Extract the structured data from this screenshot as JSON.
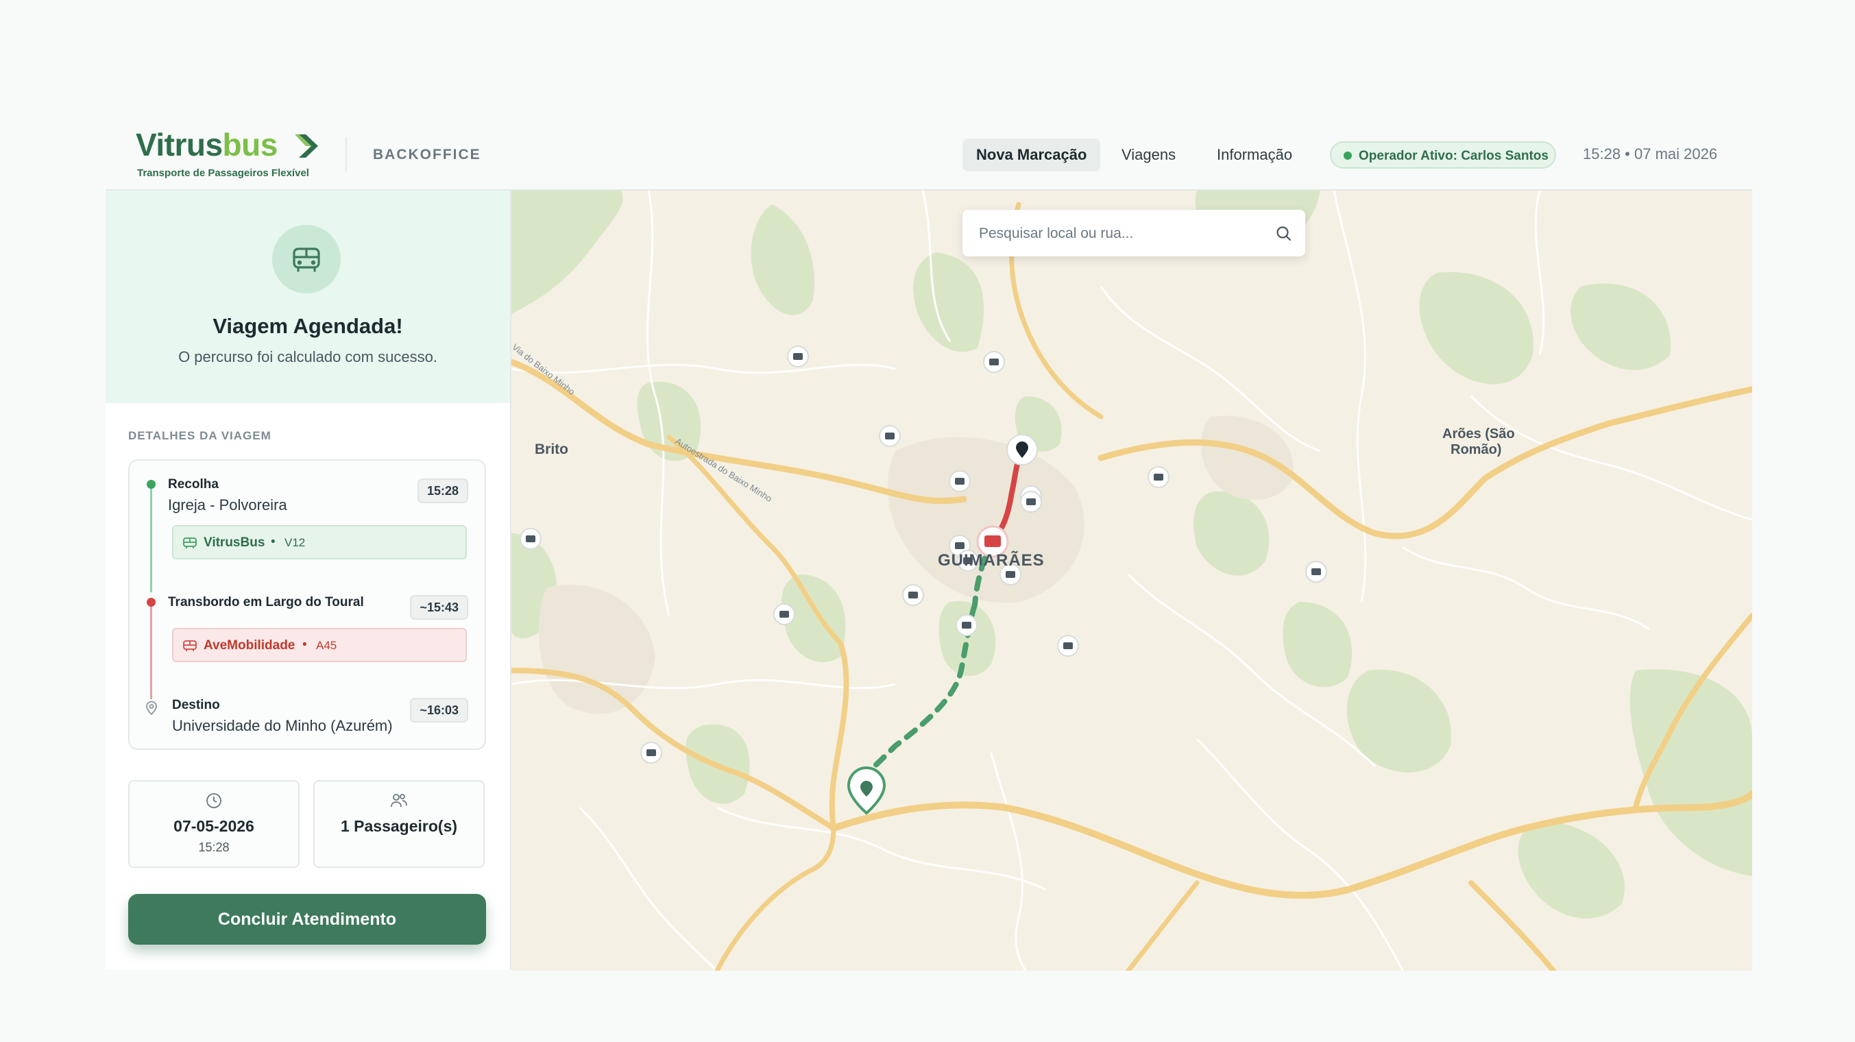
{
  "brand": {
    "name_part1": "Vitrus",
    "name_part2": "bus",
    "tagline": "Transporte de Passageiros Flexível",
    "section": "BACKOFFICE"
  },
  "nav": {
    "items": [
      {
        "label": "Nova Marcação",
        "active": true
      },
      {
        "label": "Viagens"
      },
      {
        "label": "Informação"
      }
    ]
  },
  "operator_badge": "Operador Ativo: Carlos Santos",
  "datetime": "15:28 • 07 mai 2026",
  "success": {
    "title": "Viagem Agendada!",
    "subtitle": "O percurso foi calculado com sucesso."
  },
  "details": {
    "label": "DETALHES DA VIAGEM",
    "steps": [
      {
        "title": "Recolha",
        "place": "Igreja - Polvoreira",
        "time": "15:28",
        "operator": "VitrusBus",
        "line": "V12",
        "color": "#3aa45d"
      },
      {
        "title": "Transbordo em Largo do Toural",
        "time": "~15:43",
        "operator": "AveMobilidade",
        "line": "A45",
        "color": "#d64545"
      },
      {
        "title": "Destino",
        "place": "Universidade do Minho (Azurém)",
        "time": "~16:03"
      }
    ],
    "separator": "•"
  },
  "summary": {
    "date": "07-05-2026",
    "time": "15:28",
    "passengers": "1 Passageiro(s)"
  },
  "cta": "Concluir Atendimento",
  "map": {
    "search_placeholder": "Pesquisar local ou rua...",
    "labels": {
      "brito": "Brito",
      "guimaraes": "GUIMARÃES",
      "aroes_1": "Arões (São",
      "aroes_2": "Romão)",
      "road_baixo_minho": "Via do Baixo Minho",
      "road_autoestrada": "Autoestrada do Baixo Minho"
    },
    "route_colors": {
      "vitrusbus": "#3aa45d",
      "avemobilidade": "#d64545"
    }
  }
}
